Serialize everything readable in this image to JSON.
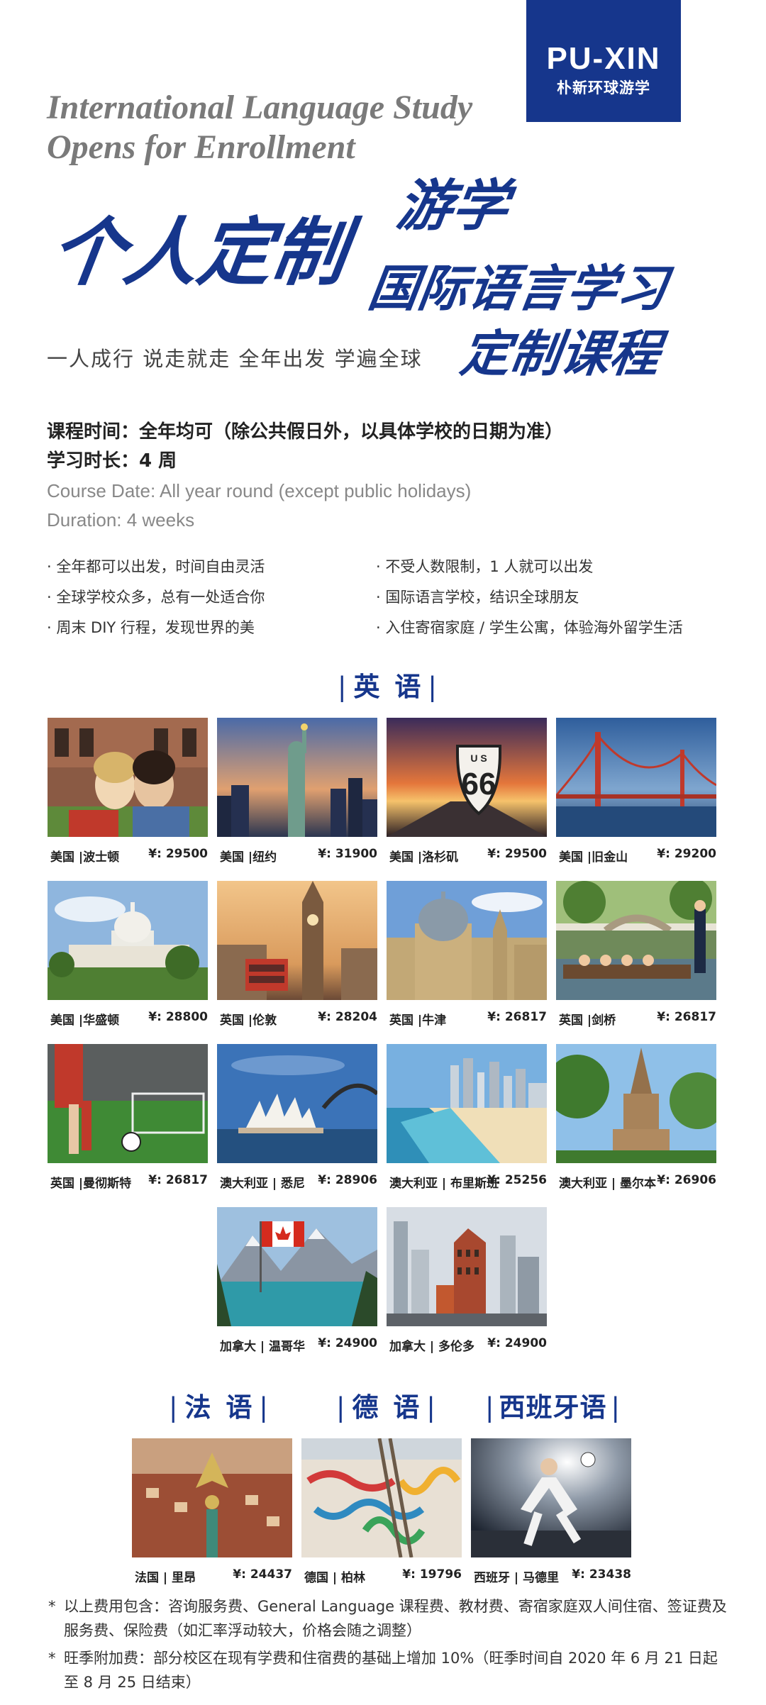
{
  "logo": {
    "brand": "PU-XIN",
    "brand_cn": "朴新环球游学"
  },
  "headline_en": {
    "line1": "International Language Study",
    "line2": "Opens for Enrollment"
  },
  "headline_cn": {
    "part1": "个人定制",
    "part2": "游学",
    "part3": "国际语言学习",
    "part4": "定制课程"
  },
  "slogan": "一人成行  说走就走  全年出发  学遍全球",
  "info": {
    "date_cn": "课程时间：全年均可（除公共假日外，以具体学校的日期为准）",
    "duration_cn": "学习时长：4 周",
    "date_en": "Course Date: All year round (except public holidays)",
    "duration_en": "Duration: 4 weeks"
  },
  "bullets": [
    "· 全年都可以出发，时间自由灵活",
    "· 不受人数限制，1 人就可以出发",
    "· 全球学校众多，总有一处适合你",
    "· 国际语言学校，结识全球朋友",
    "· 周末 DIY 行程，发现世界的美",
    "· 入住寄宿家庭 / 学生公寓，体验海外留学生活"
  ],
  "sections": {
    "english": "英 语",
    "french": "法 语",
    "german": "德 语",
    "spanish": "西班牙语"
  },
  "english_destinations": [
    {
      "place": "美国 |波士顿",
      "price": "¥:  29500"
    },
    {
      "place": "美国 |纽约",
      "price": "¥:  31900"
    },
    {
      "place": "美国 |洛杉矶",
      "price": "¥:  29500"
    },
    {
      "place": "美国 |旧金山",
      "price": "¥:  29200"
    },
    {
      "place": "美国 |华盛顿",
      "price": "¥:  28800"
    },
    {
      "place": "英国 |伦敦",
      "price": "¥:  28204"
    },
    {
      "place": "英国 |牛津",
      "price": "¥:  26817"
    },
    {
      "place": "英国 |剑桥",
      "price": "¥:  26817"
    },
    {
      "place": "英国 |曼彻斯特",
      "price": "¥:  26817"
    },
    {
      "place": "澳大利亚 | 悉尼",
      "price": "¥:  28906"
    },
    {
      "place": "澳大利亚 | 布里斯班",
      "price": "¥:  25256"
    },
    {
      "place": "澳大利亚 | 墨尔本",
      "price": "¥:  26906"
    },
    {
      "place": "加拿大 | 温哥华",
      "price": "¥:  24900"
    },
    {
      "place": "加拿大 | 多伦多",
      "price": "¥:  24900"
    }
  ],
  "other_destinations": [
    {
      "place": "法国 | 里昂",
      "price": "¥:  24437"
    },
    {
      "place": "德国 | 柏林",
      "price": "¥:  19796"
    },
    {
      "place": "西班牙 | 马德里",
      "price": "¥:  23438"
    }
  ],
  "route_sign": {
    "top": "U S",
    "number": "66"
  },
  "notes": [
    {
      "mark": "*",
      "line1": "以上费用包含：咨询服务费、General Language 课程费、教材费、寄宿家庭双人间住宿、签证费及",
      "line2": "服务费、保险费（如汇率浮动较大，价格会随之调整）"
    },
    {
      "mark": "*",
      "line1": "旺季附加费：部分校区在现有学费和住宿费的基础上增加 10%（旺季时间自 2020 年 6 月 21 日起",
      "line2": "至 8 月 25 日结束）"
    }
  ],
  "colors": {
    "brand_blue": "#16368c",
    "gray_heading": "#7a7a7a"
  }
}
